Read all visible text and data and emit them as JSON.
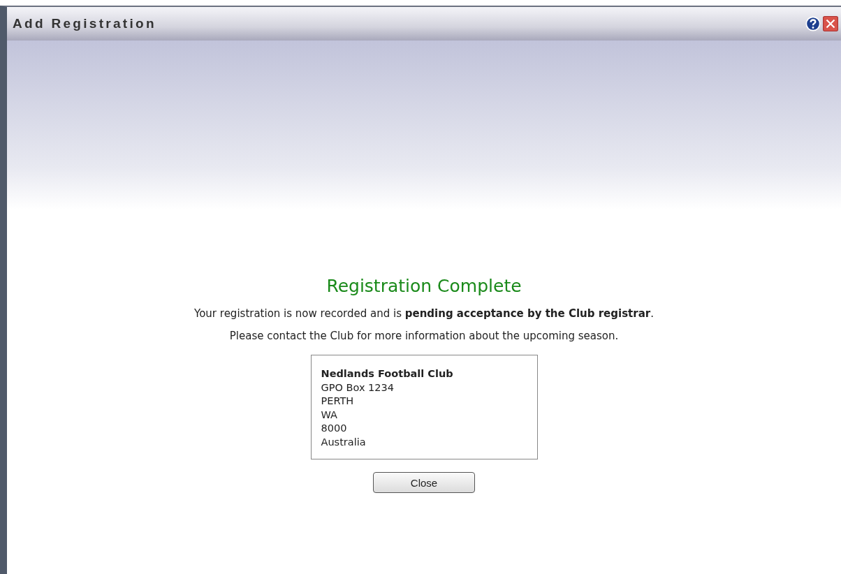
{
  "window": {
    "title": "Add Registration"
  },
  "heading": "Registration Complete",
  "message": "Your registration is now recorded and is **pending acceptance by the Club registrar**.",
  "note": "Please contact the Club for more information about the upcoming season.",
  "address": {
    "name": "Nedlands Football Club",
    "lines": [
      "GPO Box 1234",
      "PERTH",
      "WA",
      "8000",
      "Australia"
    ]
  },
  "buttons": [
    "Close"
  ]
}
